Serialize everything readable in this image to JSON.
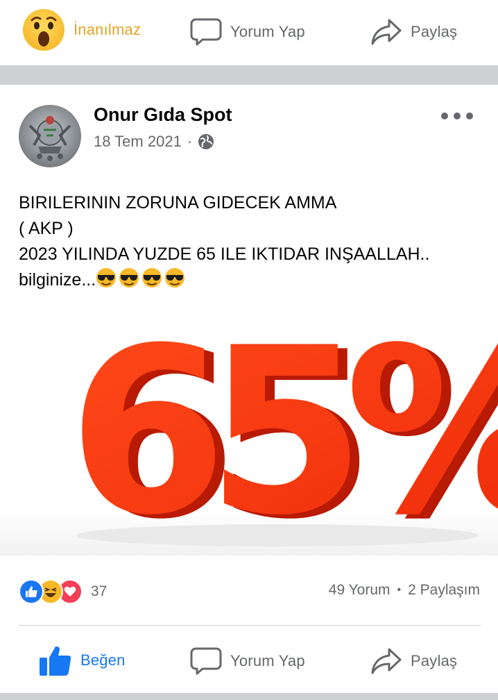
{
  "top_actions": {
    "reaction_label": "İnanılmaz",
    "comment_label": "Yorum Yap",
    "share_label": "Paylaş",
    "reaction_color": "#e4a42a"
  },
  "post": {
    "page_name": "Onur Gıda Spot",
    "date": "18 Tem 2021",
    "separator": "·",
    "privacy_icon": "globe-icon",
    "text_lines": [
      "BIRILERININ ZORUNA GIDECEK AMMA",
      "( AKP )",
      "2023 YILINDA YUZDE 65 ILE IKTIDAR INŞAALLAH..",
      "bilginize..."
    ],
    "emoji_count": 4,
    "image_text": "65%",
    "image_color": "#f23b10"
  },
  "engagement": {
    "reaction_icons": [
      "like-icon",
      "haha-icon",
      "love-icon"
    ],
    "reaction_count": "37",
    "comments": "49 Yorum",
    "dot": "•",
    "shares": "2 Paylaşım"
  },
  "bottom_actions": {
    "like_label": "Beğen",
    "comment_label": "Yorum Yap",
    "share_label": "Paylaş",
    "like_color": "#1877f2"
  }
}
